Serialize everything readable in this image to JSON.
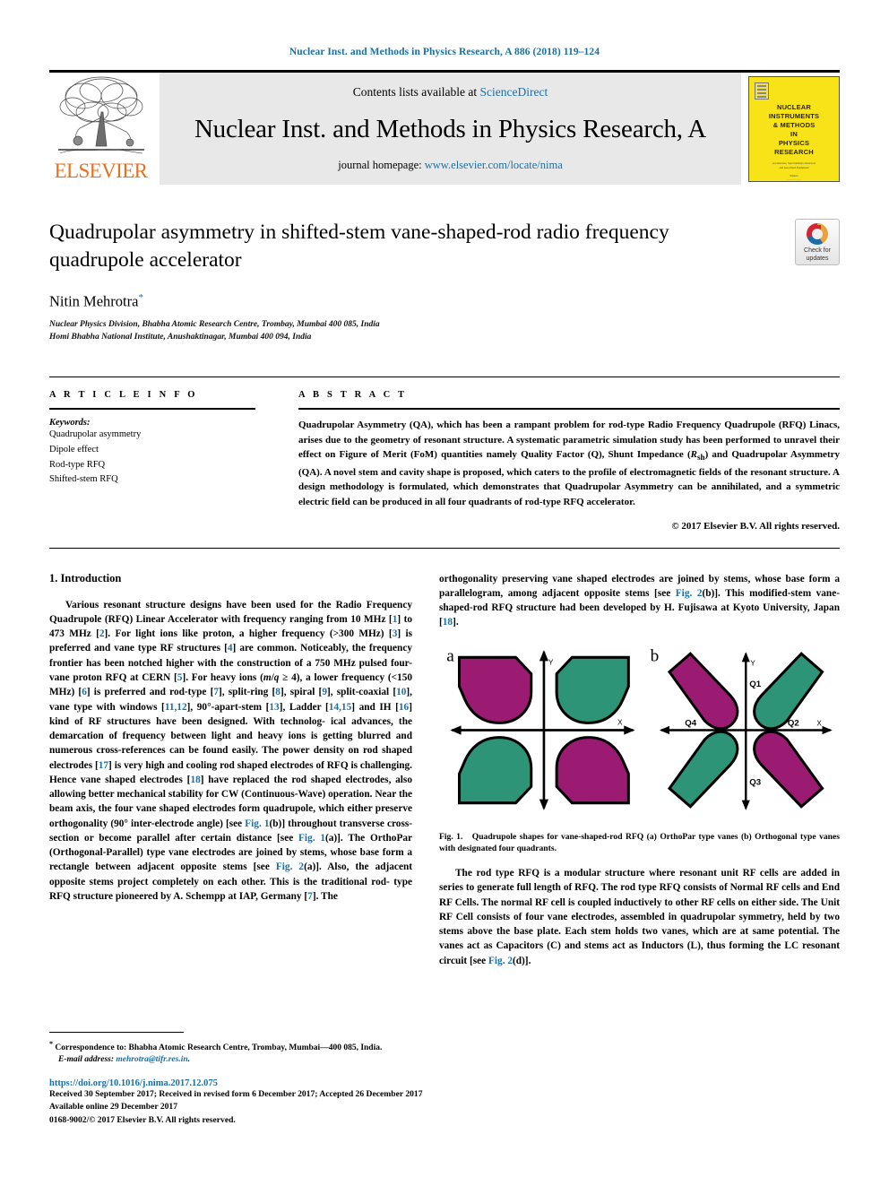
{
  "running_head": "Nuclear Inst. and Methods in Physics Research, A 886 (2018) 119–124",
  "masthead": {
    "contents_prefix": "Contents lists available at ",
    "contents_link": "ScienceDirect",
    "journal_title": "Nuclear Inst. and Methods in Physics Research, A",
    "homepage_prefix": "journal homepage: ",
    "homepage_link": "www.elsevier.com/locate/nima",
    "publisher_wordmark": "ELSEVIER",
    "cover_title": "NUCLEAR INSTRUMENTS & METHODS IN PHYSICS RESEARCH",
    "cover_lines": [
      "NUCLEAR",
      "INSTRUMENTS",
      "& METHODS",
      "IN",
      "PHYSICS",
      "RESEARCH"
    ]
  },
  "title": {
    "text": "Quadrupolar asymmetry in shifted-stem vane-shaped-rod radio frequency quadrupole accelerator",
    "crossmark_label": "Check for updates"
  },
  "author": {
    "name": "Nitin Mehrotra",
    "corresponding_marker": "*",
    "affiliations": [
      "Nuclear Physics Division, Bhabha Atomic Research Centre, Trombay, Mumbai 400 085, India",
      "Homi Bhabha National Institute, Anushaktinagar, Mumbai 400 094, India"
    ]
  },
  "article_info": {
    "heading": "A R T I C L E    I N F O",
    "keywords_heading": "Keywords:",
    "keywords": [
      "Quadrupolar asymmetry",
      "Dipole effect",
      "Rod-type RFQ",
      "Shifted-stem RFQ"
    ]
  },
  "abstract": {
    "heading": "A B S T R A C T",
    "text": "Quadrupolar Asymmetry (QA), which has been a rampant problem for rod-type Radio Frequency Quadrupole (RFQ) Linacs, arises due to the geometry of resonant structure. A systematic parametric simulation study has been performed to unravel their effect on Figure of Merit (FoM) quantities namely Quality Factor (Q), Shunt Impedance (Rsh) and Quadrupolar Asymmetry (QA). A novel stem and cavity shape is proposed, which caters to the profile of electromagnetic fields of the resonant structure. A design methodology is formulated, which demonstrates that Quadrupolar Asymmetry can be annihilated, and a symmetric electric field can be produced in all four quadrants of rod-type RFQ accelerator.",
    "copyright": "© 2017 Elsevier B.V. All rights reserved."
  },
  "sections": {
    "intro_heading": "1.  Introduction",
    "left_paragraph_1": "Various resonant structure designs have been used for the Radio Frequency Quadrupole (RFQ) Linear Accelerator with frequency ranging from 10 MHz [1] to 473 MHz [2]. For light ions like proton, a higher frequency (>300 MHz) [3] is preferred and vane type RF structures [4] are common. Noticeably, the frequency frontier has been notched higher with the construction of a 750 MHz pulsed four-vane proton RFQ at CERN [5]. For heavy ions (m/q ≥ 4), a lower frequency (<150 MHz) [6] is preferred and rod-type [7], split-ring [8], spiral [9], split-coaxial [10], vane type with windows [11,12], 90°-apart-stem [13], Ladder [14,15] and IH [16] kind of RF structures have been designed. With technological advances, the demarcation of frequency between light and heavy ions is getting blurred and numerous cross-references can be found easily. The power density on rod shaped electrodes [17] is very high and cooling rod shaped electrodes of RFQ is challenging. Hence vane shaped electrodes [18] have replaced the rod shaped electrodes, also allowing better mechanical stability for CW (Continuous-Wave) operation. Near the beam axis, the four vane shaped electrodes form quadrupole, which either preserve orthogonality (90° inter-electrode angle) [see Fig. 1(b)] throughout transverse cross-section or become parallel after certain distance [see Fig. 1(a)]. The OrthoPar (Orthogonal-Parallel) type vane electrodes are joined by stems, whose base form a rectangle between adjacent opposite stems [see Fig. 2(a)]. Also, the adjacent opposite stems project completely on each other. This is the traditional rod-type RFQ structure pioneered by A. Schempp at IAP, Germany [7]. The",
    "right_paragraph_1": "orthogonality preserving vane shaped electrodes are joined by stems, whose base form a parallelogram, among adjacent opposite stems [see Fig. 2(b)]. This modified-stem vane-shaped-rod RFQ structure had been developed by H. Fujisawa at Kyoto University, Japan [18].",
    "right_paragraph_2": "The rod type RFQ is a modular structure where resonant unit RF cells are added in series to generate full length of RFQ. The rod type RFQ consists of Normal RF cells and End RF Cells. The normal RF cell is coupled inductively to other RF cells on either side. The Unit RF Cell consists of four vane electrodes, assembled in quadrupolar symmetry, held by two stems above the base plate. Each stem holds two vanes, which are at same potential. The vanes act as Capacitors (C) and stems act as Inductors (L), thus forming the LC resonant circuit [see Fig. 2(d)]."
  },
  "figure1": {
    "label": "Fig. 1.",
    "caption": "Quadrupole shapes for vane-shaped-rod RFQ (a) OrthoPar type vanes (b) Orthogonal type vanes with designated four quadrants.",
    "panel_a_label": "a",
    "panel_b_label": "b",
    "axis_x": "X",
    "axis_y": "Y",
    "quadrants": [
      "Q1",
      "Q2",
      "Q3",
      "Q4"
    ],
    "colors": {
      "magenta": "#9C1B72",
      "green": "#2E9478",
      "outline": "#000000"
    }
  },
  "footer": {
    "correspondence_marker": "*",
    "correspondence": "Correspondence to: Bhabha Atomic Research Centre, Trombay, Mumbai—400 085, India.",
    "email_label": "E-mail address:",
    "email": "mehrotra@tifr.res.in",
    "doi": "https://doi.org/10.1016/j.nima.2017.12.075",
    "dates": "Received 30 September 2017; Received in revised form 6 December 2017; Accepted 26 December 2017",
    "available": "Available online 29 December 2017",
    "issn_line": "0168-9002/© 2017 Elsevier B.V. All rights reserved."
  },
  "colors": {
    "link": "#1a6fa3",
    "elsevier_orange": "#E9711C",
    "cover_yellow": "#F7E317"
  }
}
